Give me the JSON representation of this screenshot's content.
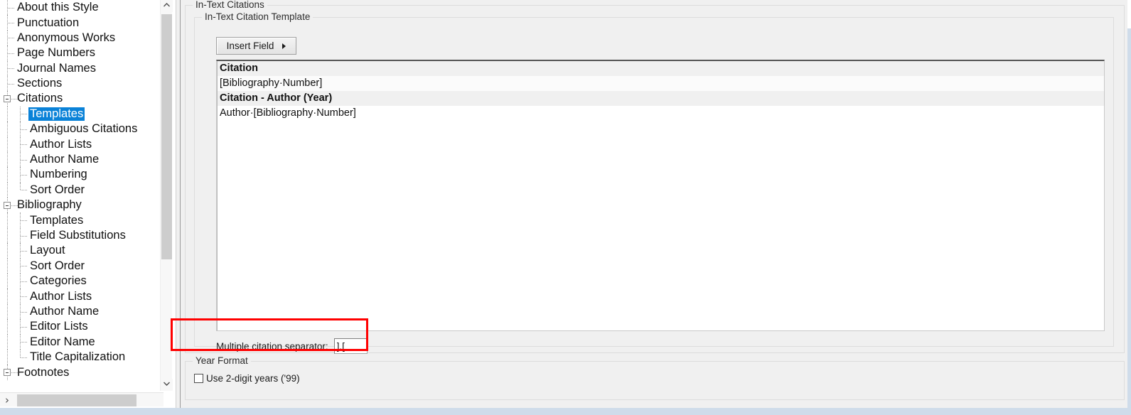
{
  "sidebar": {
    "items": [
      {
        "label": "About this Style",
        "level": 0,
        "expander": false,
        "selected": false
      },
      {
        "label": "Punctuation",
        "level": 0,
        "expander": false,
        "selected": false
      },
      {
        "label": "Anonymous Works",
        "level": 0,
        "expander": false,
        "selected": false
      },
      {
        "label": "Page Numbers",
        "level": 0,
        "expander": false,
        "selected": false
      },
      {
        "label": "Journal Names",
        "level": 0,
        "expander": false,
        "selected": false
      },
      {
        "label": "Sections",
        "level": 0,
        "expander": false,
        "selected": false
      },
      {
        "label": "Citations",
        "level": 0,
        "expander": true,
        "selected": false
      },
      {
        "label": "Templates",
        "level": 1,
        "expander": false,
        "selected": true
      },
      {
        "label": "Ambiguous Citations",
        "level": 1,
        "expander": false,
        "selected": false
      },
      {
        "label": "Author Lists",
        "level": 1,
        "expander": false,
        "selected": false
      },
      {
        "label": "Author Name",
        "level": 1,
        "expander": false,
        "selected": false
      },
      {
        "label": "Numbering",
        "level": 1,
        "expander": false,
        "selected": false
      },
      {
        "label": "Sort Order",
        "level": 1,
        "expander": false,
        "selected": false,
        "last": true
      },
      {
        "label": "Bibliography",
        "level": 0,
        "expander": true,
        "selected": false
      },
      {
        "label": "Templates",
        "level": 1,
        "expander": false,
        "selected": false
      },
      {
        "label": "Field Substitutions",
        "level": 1,
        "expander": false,
        "selected": false
      },
      {
        "label": "Layout",
        "level": 1,
        "expander": false,
        "selected": false
      },
      {
        "label": "Sort Order",
        "level": 1,
        "expander": false,
        "selected": false
      },
      {
        "label": "Categories",
        "level": 1,
        "expander": false,
        "selected": false
      },
      {
        "label": "Author Lists",
        "level": 1,
        "expander": false,
        "selected": false
      },
      {
        "label": "Author Name",
        "level": 1,
        "expander": false,
        "selected": false
      },
      {
        "label": "Editor Lists",
        "level": 1,
        "expander": false,
        "selected": false
      },
      {
        "label": "Editor Name",
        "level": 1,
        "expander": false,
        "selected": false
      },
      {
        "label": "Title Capitalization",
        "level": 1,
        "expander": false,
        "selected": false,
        "last": true
      },
      {
        "label": "Footnotes",
        "level": 0,
        "expander": true,
        "selected": false
      }
    ],
    "scrollbar": {
      "up_icon": "chevron-up-icon",
      "down_icon": "chevron-down-icon",
      "left_icon": "chevron-left-icon",
      "right_icon": "chevron-right-icon"
    }
  },
  "content": {
    "outer_group_title": "In-Text Citations",
    "template_group_title": "In-Text Citation Template",
    "insert_field_label": "Insert Field",
    "insert_field_caret_icon": "caret-right-icon",
    "template_lines": [
      {
        "text": "Citation",
        "kind": "heading"
      },
      {
        "text": "[Bibliography·Number]",
        "kind": "value-shaded"
      },
      {
        "text": "Citation - Author (Year)",
        "kind": "heading"
      },
      {
        "text": "Author·[Bibliography·Number]",
        "kind": "value"
      }
    ],
    "separator_label": "Multiple citation separator:",
    "separator_value": "],[",
    "year_group_title": "Year Format",
    "year_checkbox_label": "Use 2-digit years ('99)",
    "year_checkbox_checked": false
  },
  "annotation": {
    "highlight_color": "#ff0000",
    "highlight_target": "multiple-citation-separator-row"
  },
  "colors": {
    "selection_blue": "#0a82d8",
    "panel_gray": "#f0f0f0",
    "accent_red": "#ff0000"
  }
}
